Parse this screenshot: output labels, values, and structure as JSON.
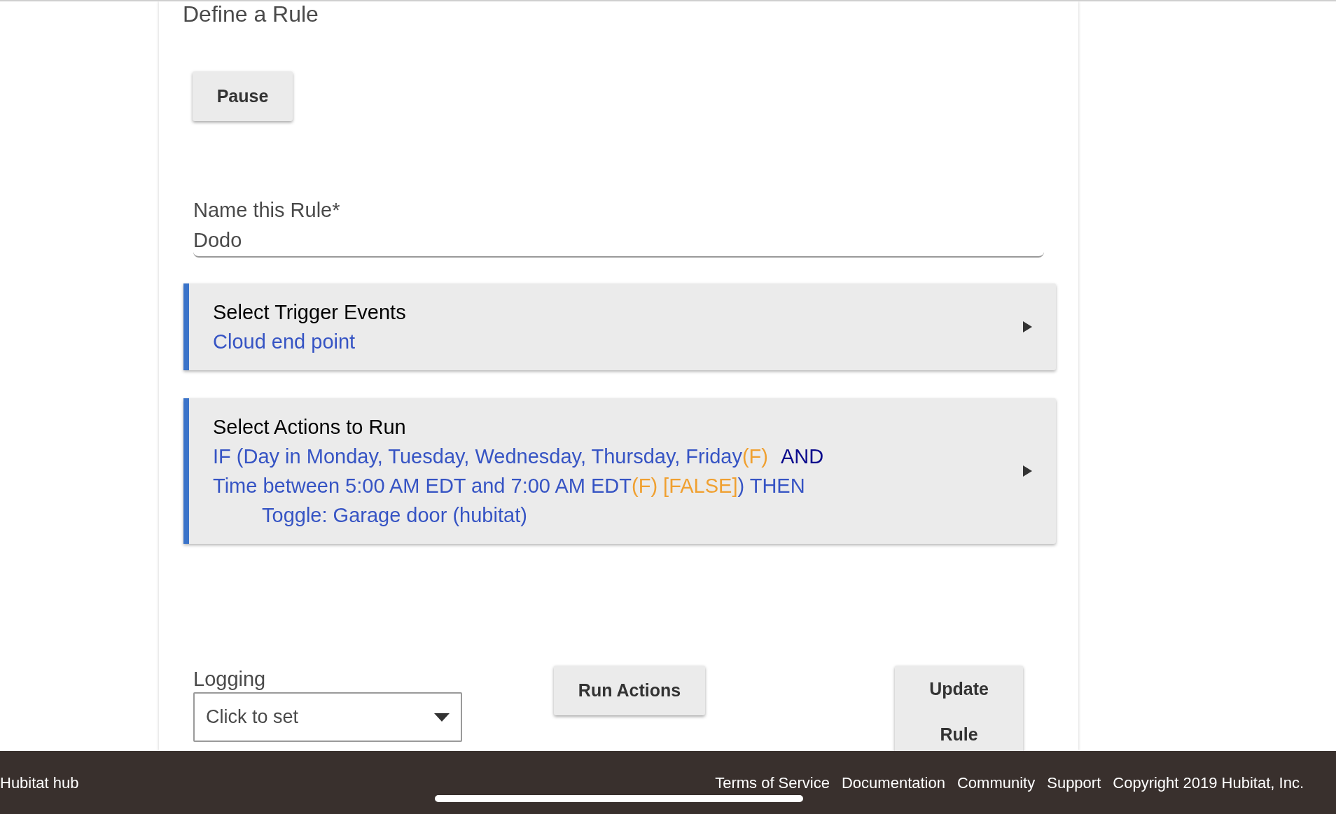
{
  "page_title": "Define a Rule",
  "pause_button": "Pause",
  "name_field": {
    "label": "Name this Rule*",
    "value": "Dodo"
  },
  "sections": [
    {
      "title": "Select Trigger Events",
      "lines": [
        {
          "kind": "condition",
          "segments": [
            {
              "text": "Cloud end point",
              "kind": "normal"
            }
          ]
        }
      ]
    },
    {
      "title": "Select Actions to Run",
      "lines": [
        {
          "kind": "condition",
          "segments": [
            {
              "text": "IF (Day in Monday, Tuesday, Wednesday, Thursday, Friday",
              "kind": "normal"
            },
            {
              "text": "(F)",
              "kind": "flag"
            },
            {
              "text": "AND",
              "kind": "keyword"
            }
          ]
        },
        {
          "kind": "condition",
          "segments": [
            {
              "text": "Time between 5:00 AM EDT and 7:00 AM EDT",
              "kind": "normal"
            },
            {
              "text": "(F) [FALSE]",
              "kind": "flag"
            },
            {
              "text": ") THEN",
              "kind": "normal"
            }
          ]
        },
        {
          "kind": "action",
          "segments": [
            {
              "text": "Toggle: Garage door (hubitat)",
              "kind": "normal"
            }
          ]
        }
      ]
    }
  ],
  "logging": {
    "label": "Logging",
    "value": "Click to set"
  },
  "run_actions_button": "Run Actions",
  "update_button": [
    "Update",
    "Rule"
  ],
  "footer": {
    "hub_name": "Hubitat hub",
    "links": [
      "Terms of Service",
      "Documentation",
      "Community",
      "Support"
    ],
    "copyright": "Copyright 2019 Hubitat, Inc."
  }
}
